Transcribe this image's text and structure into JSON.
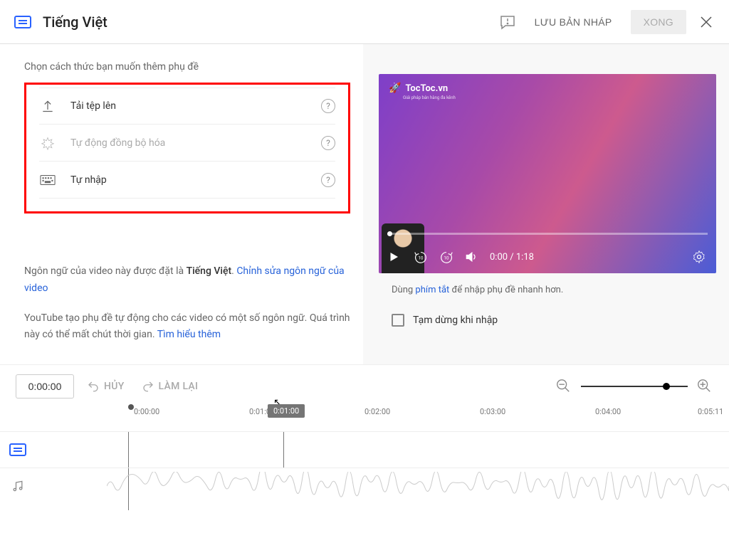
{
  "header": {
    "title": "Tiếng Việt",
    "save_draft": "LƯU BẢN NHÁP",
    "done": "XONG"
  },
  "left": {
    "prompt": "Chọn cách thức bạn muốn thêm phụ đề",
    "methods": {
      "upload": "Tải tệp lên",
      "autosync": "Tự động đồng bộ hóa",
      "manual": "Tự nhập"
    },
    "info1a": "Ngôn ngữ của video này được đặt là ",
    "info1b": "Tiếng Việt",
    "info1c": ". ",
    "edit_lang": "Chỉnh sửa ngôn ngữ của video",
    "info2a": "YouTube tạo phụ đề tự động cho các video có một số ngôn ngữ. Quá trình này có thể mất chút thời gian. ",
    "learn_more": "Tìm hiểu thêm"
  },
  "video": {
    "watermark": "TocToc.vn",
    "watermark_sub": "Giải pháp bán hàng đa kênh",
    "current": "0:00",
    "total": "1:18",
    "time_disp": "0:00 / 1:18"
  },
  "right": {
    "hint_a": "Dùng ",
    "hint_link": "phím tắt",
    "hint_b": " để nhập phụ đề nhanh hơn.",
    "checkbox_label": "Tạm dừng khi nhập"
  },
  "timeline": {
    "time_input": "0:00:00",
    "undo": "HỦY",
    "redo": "LÀM LẠI",
    "tooltip": "0:01:00",
    "ticks": [
      "0:00:00",
      "0:01:00",
      "0:02:00",
      "0:03:00",
      "0:04:00",
      "0:05:11"
    ]
  }
}
